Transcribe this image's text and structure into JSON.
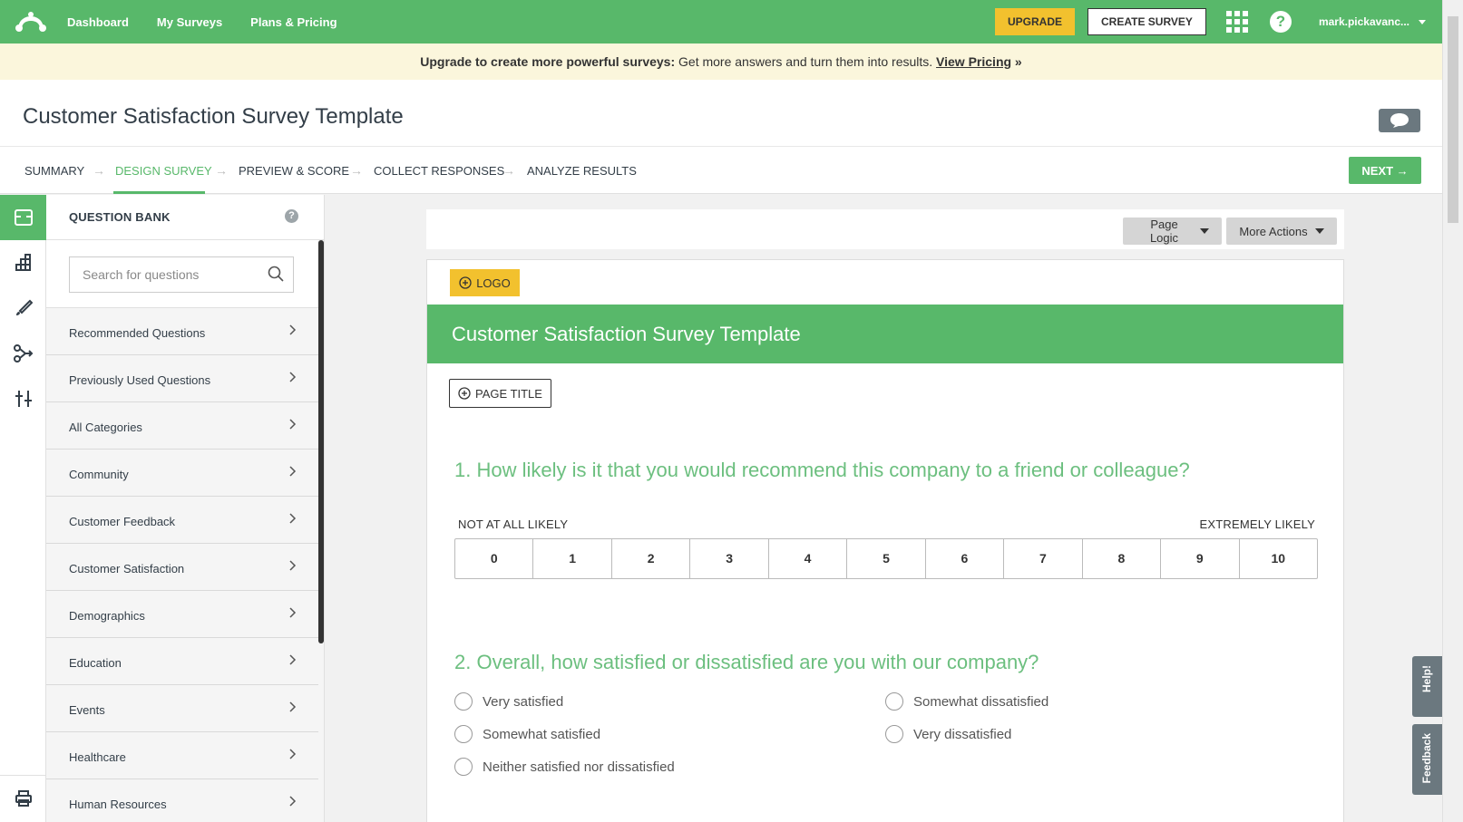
{
  "nav": {
    "links": [
      "Dashboard",
      "My Surveys",
      "Plans & Pricing"
    ],
    "upgrade": "UPGRADE",
    "create": "CREATE SURVEY",
    "help": "?",
    "user": "mark.pickavanc..."
  },
  "banner": {
    "bold": "Upgrade to create more powerful surveys:",
    "text": " Get more answers and turn them into results. ",
    "link": "View Pricing",
    "suffix": " »"
  },
  "page": {
    "title": "Customer Satisfaction Survey Template"
  },
  "steps": {
    "summary": "SUMMARY",
    "design": "DESIGN SURVEY",
    "preview": "PREVIEW & SCORE",
    "collect": "COLLECT RESPONSES",
    "analyze": "ANALYZE RESULTS",
    "next": "NEXT"
  },
  "question_bank": {
    "title": "QUESTION BANK",
    "help": "?",
    "search_placeholder": "Search for questions",
    "categories": [
      "Recommended Questions",
      "Previously Used Questions",
      "All Categories",
      "Community",
      "Customer Feedback",
      "Customer Satisfaction",
      "Demographics",
      "Education",
      "Events",
      "Healthcare",
      "Human Resources"
    ]
  },
  "toolbar": {
    "page_logic": "Page Logic",
    "more_actions": "More Actions"
  },
  "survey": {
    "logo": "LOGO",
    "title": "Customer Satisfaction Survey Template",
    "page_title": "PAGE TITLE",
    "q1": {
      "title": "1. How likely is it that you would recommend this company to a friend or colleague?",
      "low": "NOT AT ALL LIKELY",
      "high": "EXTREMELY LIKELY",
      "scale": [
        "0",
        "1",
        "2",
        "3",
        "4",
        "5",
        "6",
        "7",
        "8",
        "9",
        "10"
      ]
    },
    "q2": {
      "title": "2. Overall, how satisfied or dissatisfied are you with our company?",
      "options": [
        "Very satisfied",
        "Somewhat satisfied",
        "Neither satisfied nor dissatisfied",
        "Somewhat dissatisfied",
        "Very dissatisfied"
      ]
    }
  },
  "side_tabs": {
    "help": "Help!",
    "feedback": "Feedback"
  },
  "colors": {
    "brand": "#58b86a",
    "upgrade": "#f2c12e",
    "question": "#6cbf7f",
    "banner": "#fbf6dc"
  }
}
